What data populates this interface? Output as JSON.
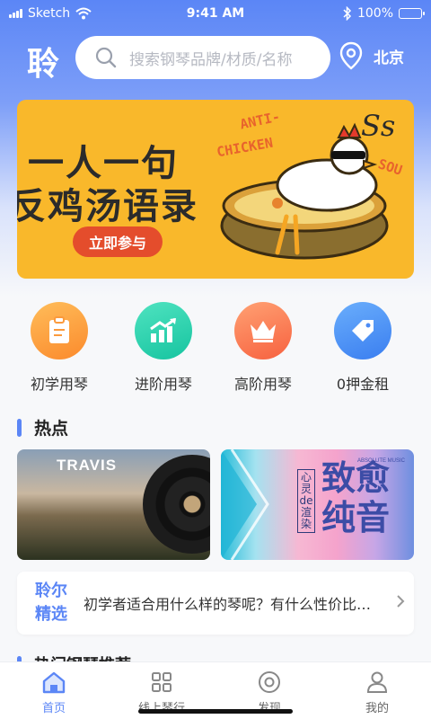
{
  "status_bar": {
    "carrier": "Sketch",
    "time": "9:41 AM",
    "battery": "100%"
  },
  "header": {
    "logo": "聆",
    "search_placeholder": "搜索钢琴品牌/材质/名称",
    "city": "北京"
  },
  "banner": {
    "title_line1": "一人一句",
    "title_line2": "反鸡汤语录",
    "cta": "立即参与",
    "deco_anti": "ANTI-",
    "deco_chicken": "CHICKEN",
    "deco_ss": "Ss",
    "deco_sou": "SOU"
  },
  "categories": [
    {
      "label": "初学用琴",
      "icon": "clipboard-icon",
      "color": "#fb9a3c"
    },
    {
      "label": "进阶用琴",
      "icon": "chart-up-icon",
      "color": "#2ed3b1"
    },
    {
      "label": "高阶用琴",
      "icon": "crown-icon",
      "color": "#fb7a55"
    },
    {
      "label": "0押金租",
      "icon": "tag-icon",
      "color": "#4d8cf5"
    }
  ],
  "hot": {
    "title": "热点",
    "cards": [
      {
        "name": "travis-album",
        "caption": "TRAVIS"
      },
      {
        "name": "healing-music",
        "vertical": "心灵de渲染",
        "big": "致愈纯音",
        "small": "ABSOLUTE MUSIC"
      }
    ]
  },
  "notice": {
    "tag_line1": "聆尔",
    "tag_line2": "精选",
    "message": "初学者适合用什么样的琴呢？有什么性价比…"
  },
  "next_section": {
    "title": "热门钢琴推荐"
  },
  "tabbar": [
    {
      "label": "首页",
      "icon": "home-icon",
      "active": true
    },
    {
      "label": "线上琴行",
      "icon": "grid-icon",
      "active": false
    },
    {
      "label": "发现",
      "icon": "discover-icon",
      "active": false
    },
    {
      "label": "我的",
      "icon": "profile-icon",
      "active": false
    }
  ],
  "colors": {
    "accent": "#5b86f6",
    "banner_bg": "#f9b82b",
    "cta_bg": "#e44d2c"
  }
}
